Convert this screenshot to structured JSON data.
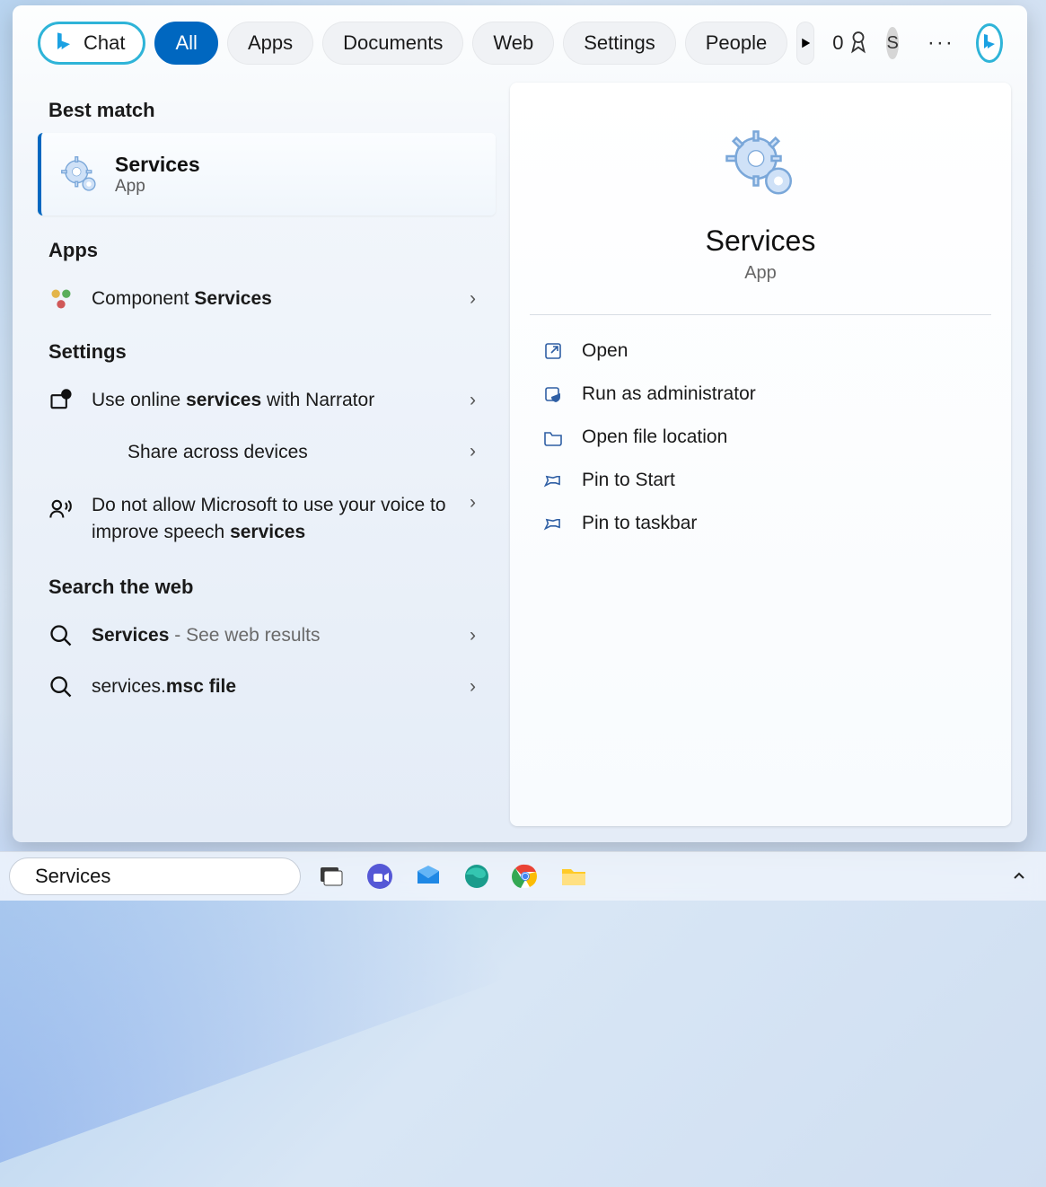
{
  "tabs": {
    "chat": "Chat",
    "all": "All",
    "apps": "Apps",
    "documents": "Documents",
    "web": "Web",
    "settings": "Settings",
    "people": "People"
  },
  "reward_count": "0",
  "avatar_initial": "S",
  "sections": {
    "best_match": "Best match",
    "apps": "Apps",
    "settings": "Settings",
    "search_web": "Search the web"
  },
  "best": {
    "title": "Services",
    "subtitle": "App"
  },
  "apps_result": {
    "prefix": "Component ",
    "match": "Services"
  },
  "settings_results": {
    "r1_pre": "Use online ",
    "r1_match": "services",
    "r1_post": " with Narrator",
    "r2": "Share across devices",
    "r3_line": "Do not allow Microsoft to use your voice to improve speech ",
    "r3_match": "services"
  },
  "web_results": {
    "w1_match": "Services",
    "w1_tail": " - See web results",
    "w2_pre": "services.",
    "w2_match": "msc file"
  },
  "preview": {
    "title": "Services",
    "subtitle": "App",
    "actions": {
      "open": "Open",
      "admin": "Run as administrator",
      "location": "Open file location",
      "pin_start": "Pin to Start",
      "pin_taskbar": "Pin to taskbar"
    }
  },
  "search_input": "Services"
}
